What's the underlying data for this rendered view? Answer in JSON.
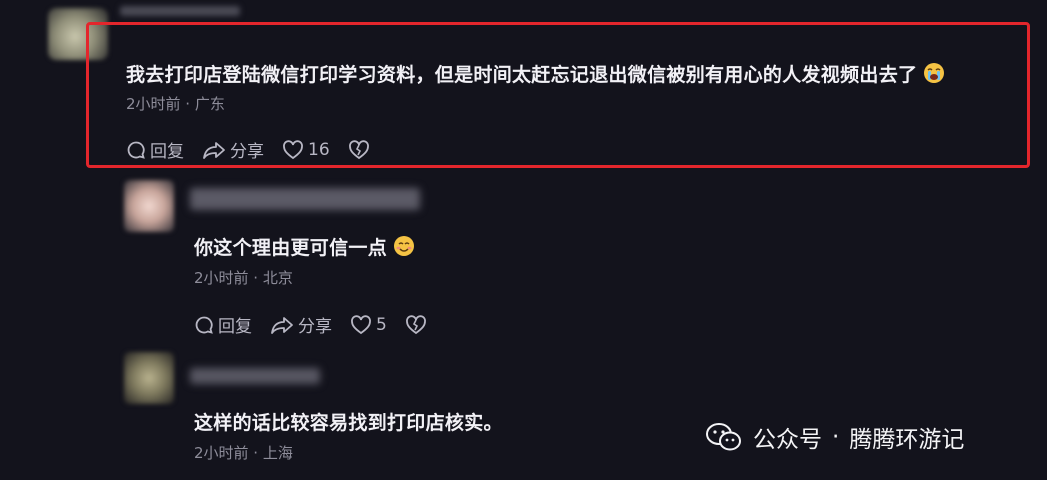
{
  "comments": [
    {
      "text": "我去打印店登陆微信打印学习资料，但是时间太赶忘记退出微信被别有用心的人发视频出去了",
      "emoji": "crying-face-emoji",
      "meta": "2小时前 · 广东",
      "reply_label": "回复",
      "share_label": "分享",
      "like_count": "16"
    },
    {
      "text": "你这个理由更可信一点",
      "emoji": "smiling-face-emoji",
      "meta": "2小时前 · 北京",
      "reply_label": "回复",
      "share_label": "分享",
      "like_count": "5"
    },
    {
      "text": "这样的话比较容易找到打印店核实。",
      "meta": "2小时前 · 上海"
    }
  ],
  "watermark": {
    "account_label": "公众号",
    "separator": "·",
    "account_name": "腾腾环游记",
    "icon": "wechat-logo-icon"
  },
  "colors": {
    "background": "#13131c",
    "highlight": "#e3262c",
    "meta_text": "#8e8d9a"
  }
}
